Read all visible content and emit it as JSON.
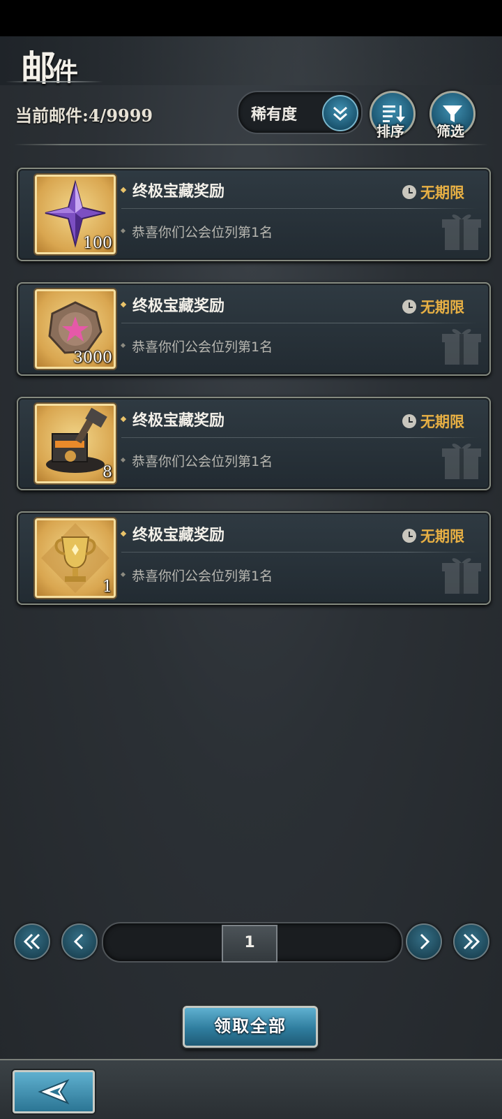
{
  "header": {
    "title_main": "邮",
    "title_rest": "件",
    "mail_count_label": "当前邮件:4/9999"
  },
  "toolbar": {
    "rarity_label": "稀有度",
    "sort_label": "排序",
    "filter_label": "筛选"
  },
  "mails": [
    {
      "title": "终极宝藏奖励",
      "subtitle": "恭喜你们公会位列第1名",
      "expiry": "无期限",
      "item_icon": "purple-star-crystal-icon",
      "quantity": "100"
    },
    {
      "title": "终极宝藏奖励",
      "subtitle": "恭喜你们公会位列第1名",
      "expiry": "无期限",
      "item_icon": "star-medallion-icon",
      "quantity": "3000"
    },
    {
      "title": "终极宝藏奖励",
      "subtitle": "恭喜你们公会位列第1名",
      "expiry": "无期限",
      "item_icon": "forge-hammer-icon",
      "quantity": "8"
    },
    {
      "title": "终极宝藏奖励",
      "subtitle": "恭喜你们公会位列第1名",
      "expiry": "无期限",
      "item_icon": "gold-trophy-icon",
      "quantity": "1"
    }
  ],
  "pagination": {
    "current_page": "1"
  },
  "actions": {
    "claim_all_label": "领取全部"
  },
  "colors": {
    "accent_blue": "#2f7d9e",
    "expiry_gold": "#e8b044",
    "item_frame_gold": "#d9a650"
  }
}
